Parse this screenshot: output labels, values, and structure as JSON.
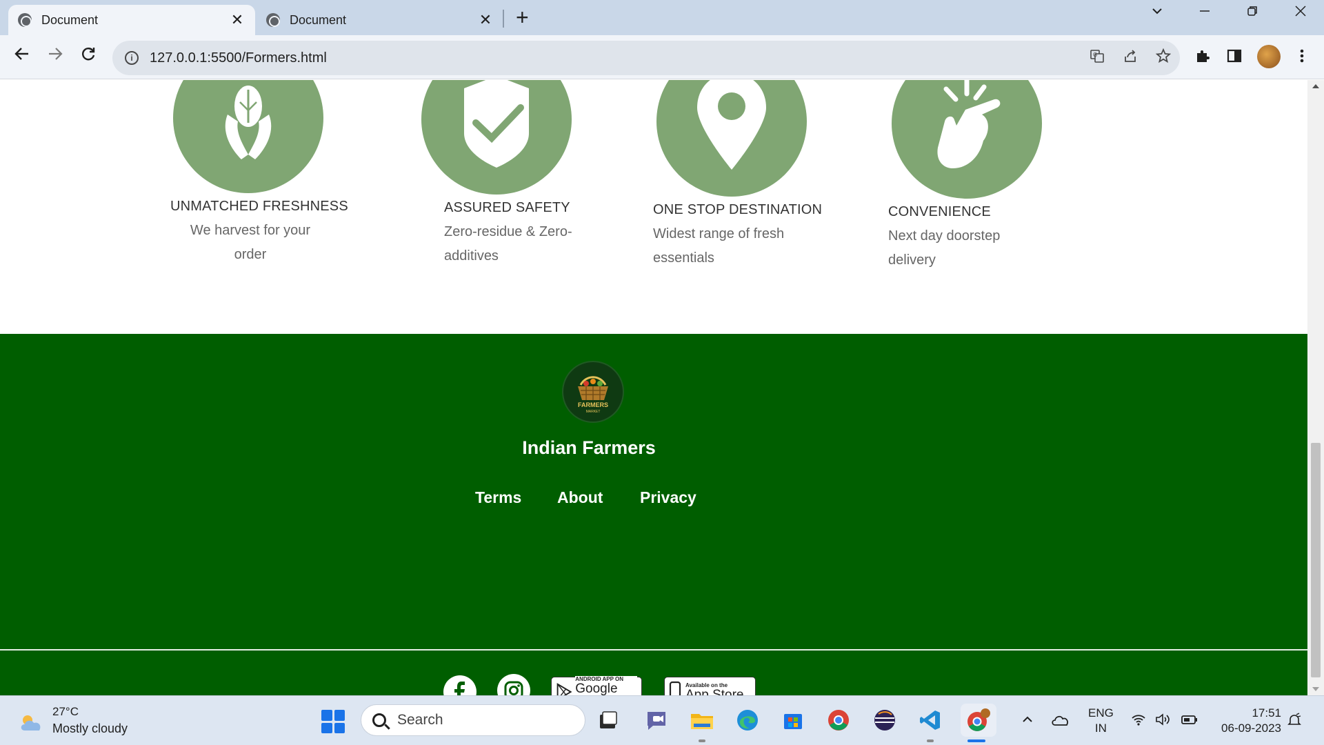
{
  "browser": {
    "tabs": [
      {
        "title": "Document",
        "close": "✕"
      },
      {
        "title": "Document",
        "close": "✕"
      }
    ],
    "new_tab": "+",
    "url": "127.0.0.1:5500/Formers.html",
    "info_glyph": "i"
  },
  "features": [
    {
      "title": "UNMATCHED FRESHNESS",
      "desc": "We harvest for your order",
      "icon": "hands-leaf-icon"
    },
    {
      "title": "ASSURED SAFETY",
      "desc": "Zero-residue & Zero-additives",
      "icon": "shield-check-icon"
    },
    {
      "title": "ONE STOP DESTINATION",
      "desc": "Widest range of fresh essentials",
      "icon": "location-pin-icon"
    },
    {
      "title": "CONVENIENCE",
      "desc": "Next day doorstep delivery",
      "icon": "tap-hand-icon"
    }
  ],
  "footer": {
    "brand": "Indian Farmers",
    "logo_text": "FARMERS",
    "logo_subtext": "MARKET",
    "links": [
      "Terms",
      "About",
      "Privacy"
    ],
    "google_play": {
      "small": "ANDROID APP ON",
      "big": "Google Play"
    },
    "app_store": {
      "small": "Available on the",
      "big": "App Store"
    },
    "colors": {
      "footer_bg": "#005e00",
      "feature_circle": "#80a673"
    }
  },
  "taskbar": {
    "weather_temp": "27°C",
    "weather_desc": "Mostly cloudy",
    "search_placeholder": "Search",
    "lang_line1": "ENG",
    "lang_line2": "IN",
    "time": "17:51",
    "date": "06-09-2023"
  }
}
